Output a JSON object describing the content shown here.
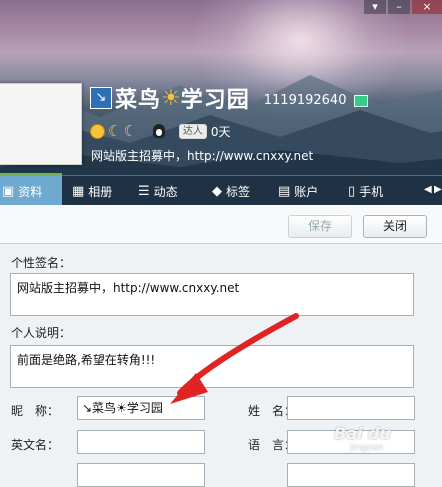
{
  "window": {
    "close_glyph": "×"
  },
  "profile": {
    "nick_prefix_icon": "↘",
    "nick_part1": "菜鸟",
    "nick_sun": "☀",
    "nick_part2": "学习园",
    "qq_number": "1119192640",
    "badge_label": "达人",
    "days": "0天",
    "signature": "网站版主招募中，http://www.cnxxy.net"
  },
  "tabs": [
    {
      "label": "资料",
      "icon": "profile-card-icon",
      "glyph": "▣"
    },
    {
      "label": "相册",
      "icon": "photo-album-icon",
      "glyph": "▦"
    },
    {
      "label": "动态",
      "icon": "feed-list-icon",
      "glyph": "☰"
    },
    {
      "label": "标签",
      "icon": "tag-icon",
      "glyph": "◆"
    },
    {
      "label": "账户",
      "icon": "wallet-icon",
      "glyph": "▤"
    },
    {
      "label": "手机",
      "icon": "phone-icon",
      "glyph": "▯"
    }
  ],
  "toolbar": {
    "save_label": "保存",
    "close_label": "关闭"
  },
  "form": {
    "signature_label": "个性签名：",
    "signature_value": "网站版主招募中，http://www.cnxxy.net",
    "description_label": "个人说明：",
    "description_value": "前面是绝路,希望在转角!!!",
    "nickname_label": "昵　称：",
    "nickname_value": "↘菜鸟☀学习园",
    "name_label": "姓　名：",
    "name_value": "",
    "english_name_label": "英文名：",
    "english_name_value": "",
    "language_label": "语　言：",
    "language_value": ""
  },
  "colors": {
    "tab_active": "#6fa9cf",
    "tab_bar": "#1f3245",
    "annotation_arrow": "#e02424"
  },
  "watermark": {
    "text": "Bai du",
    "sub": "jingyan"
  }
}
